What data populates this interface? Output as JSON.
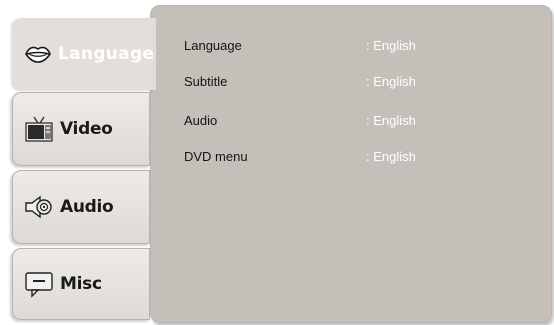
{
  "tabs": [
    {
      "label": "Language",
      "icon": "lips-icon",
      "active": true
    },
    {
      "label": "Video",
      "icon": "tv-icon",
      "active": false
    },
    {
      "label": "Audio",
      "icon": "speaker-icon",
      "active": false
    },
    {
      "label": "Misc",
      "icon": "chat-icon",
      "active": false
    }
  ],
  "settings": [
    {
      "label": "Language",
      "value": ": English"
    },
    {
      "label": "Subtitle",
      "value": ": English"
    },
    {
      "label": "Audio",
      "value": ": English"
    },
    {
      "label": "DVD menu",
      "value": ": English"
    }
  ],
  "colors": {
    "panel": "#c5bfba",
    "active_tab": "#e2ded9",
    "value_text": "#ffffff",
    "label_text": "#141414"
  }
}
